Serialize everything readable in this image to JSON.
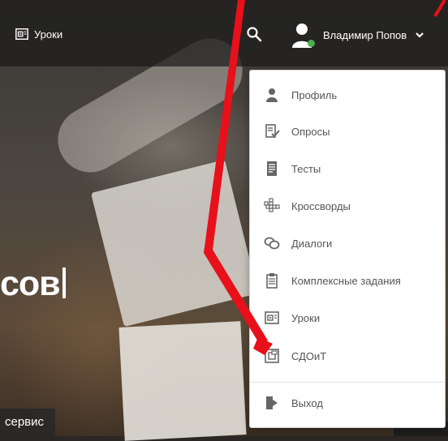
{
  "nav": {
    "lessons_label": "Уроки"
  },
  "user": {
    "name": "Владимир Попов"
  },
  "menu": {
    "items": [
      {
        "label": "Профиль",
        "icon": "user-icon"
      },
      {
        "label": "Опросы",
        "icon": "survey-icon"
      },
      {
        "label": "Тесты",
        "icon": "test-icon"
      },
      {
        "label": "Кроссворды",
        "icon": "crossword-icon"
      },
      {
        "label": "Диалоги",
        "icon": "dialog-icon"
      },
      {
        "label": "Комплексные задания",
        "icon": "complex-task-icon"
      },
      {
        "label": "Уроки",
        "icon": "lesson-icon"
      },
      {
        "label": "СДОиТ",
        "icon": "sdoit-icon"
      },
      {
        "label": "Выход",
        "icon": "logout-icon"
      }
    ]
  },
  "hero": {
    "title_fragment": "сов",
    "service_label": "сервис"
  },
  "colors": {
    "topbar": "#1c1c1c",
    "online": "#4caf50",
    "annotation": "#e8101a",
    "menu_icon": "#666666"
  }
}
